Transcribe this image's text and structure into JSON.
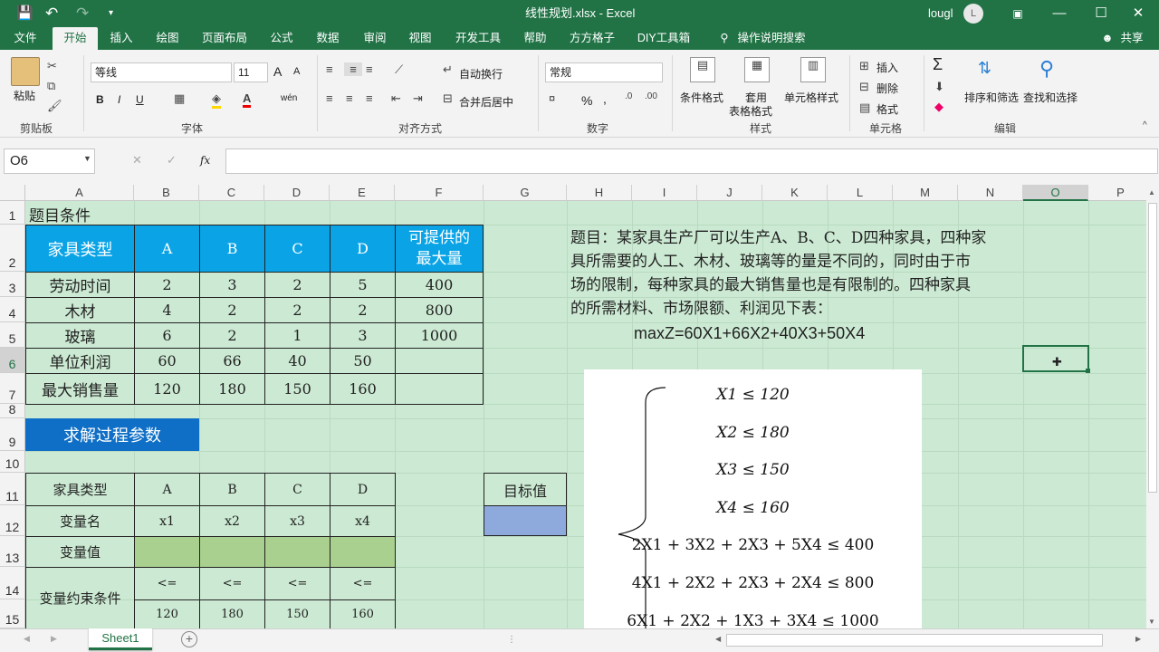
{
  "titlebar": {
    "save_icon": "save-icon",
    "undo": "↶",
    "redo": "↷",
    "title": "线性规划.xlsx  -  Excel",
    "user": "lougl",
    "avatar": "L"
  },
  "tabs": [
    "文件",
    "开始",
    "插入",
    "绘图",
    "页面布局",
    "公式",
    "数据",
    "审阅",
    "视图",
    "开发工具",
    "帮助",
    "方方格子",
    "DIY工具箱",
    "操作说明搜索"
  ],
  "share": "共享",
  "ribbon": {
    "clipboard": {
      "paste": "粘贴",
      "label": "剪贴板"
    },
    "font": {
      "name": "等线",
      "size": "11",
      "bold": "B",
      "italic": "I",
      "underline": "U",
      "inc": "A",
      "dec": "A",
      "wen": "wén",
      "label": "字体"
    },
    "align": {
      "wrap": "自动换行",
      "merge": "合并后居中",
      "label": "对齐方式"
    },
    "number": {
      "format": "常规",
      "percent": "%",
      "comma": ",",
      "label": "数字"
    },
    "styles": {
      "cond": "条件格式",
      "table1": "套用",
      "table2": "表格格式",
      "cell": "单元格样式",
      "label": "样式"
    },
    "cells": {
      "insert": "插入",
      "delete": "删除",
      "format": "格式",
      "label": "单元格"
    },
    "edit": {
      "sigma": "Σ",
      "sort": "排序和筛选",
      "find": "查找和选择",
      "label": "编辑"
    }
  },
  "formula": {
    "namebox": "O6",
    "fx": "fx",
    "value": ""
  },
  "columns": [
    "A",
    "B",
    "C",
    "D",
    "E",
    "F",
    "G",
    "H",
    "I",
    "J",
    "K",
    "L",
    "M",
    "N",
    "O",
    "P"
  ],
  "rows": [
    "1",
    "2",
    "3",
    "4",
    "5",
    "6",
    "7",
    "8",
    "9",
    "10",
    "11",
    "12",
    "13",
    "14",
    "15"
  ],
  "sheet": {
    "a1": "题目条件",
    "header": [
      "家具类型",
      "A",
      "B",
      "C",
      "D"
    ],
    "header_max": [
      "可提供的",
      "最大量"
    ],
    "table": [
      [
        "劳动时间",
        "2",
        "3",
        "2",
        "5",
        "400"
      ],
      [
        "木材",
        "4",
        "2",
        "2",
        "2",
        "800"
      ],
      [
        "玻璃",
        "6",
        "2",
        "1",
        "3",
        "1000"
      ],
      [
        "单位利润",
        "60",
        "66",
        "40",
        "50",
        ""
      ],
      [
        "最大销售量",
        "120",
        "180",
        "150",
        "160",
        ""
      ]
    ],
    "params_title": "求解过程参数",
    "p_header": [
      "家具类型",
      "A",
      "B",
      "C",
      "D"
    ],
    "p_varname": [
      "变量名",
      "x1",
      "x2",
      "x3",
      "x4"
    ],
    "p_varval": "变量值",
    "p_constraint": "变量约束条件",
    "p_le": [
      "<=",
      "<=",
      "<=",
      "<="
    ],
    "p_limits": [
      "120",
      "180",
      "150",
      "160"
    ],
    "target": "目标值",
    "problem": [
      "题目：某家具生产厂可以生产A、B、C、D四种家具，四种家",
      "具所需要的人工、木材、玻璃等的量是不同的，同时由于市",
      "场的限制，每种家具的最大销售量也是有限制的。四种家具",
      "的所需材料、市场限额、利润见下表："
    ],
    "objective": "maxZ=60X1+66X2+40X3+50X4",
    "equations": [
      "X1 ≤ 120",
      "X2 ≤ 180",
      "X3 ≤ 150",
      "X4 ≤ 160",
      "2X1 + 3X2 + 2X3 + 5X4 ≤ 400",
      "4X1 + 2X2 + 2X3 + 2X4 ≤ 800",
      "6X1 + 2X2 + 1X3 + 3X4 ≤ 1000"
    ]
  },
  "sheet_tab": "Sheet1",
  "colors": {
    "excel_green": "#217346",
    "grid_bg": "#ccead3",
    "header_blue": "#0aa4e6",
    "dark_blue": "#0f6fc6",
    "var_green": "#a9d08e",
    "target_blue": "#8ea9db"
  }
}
